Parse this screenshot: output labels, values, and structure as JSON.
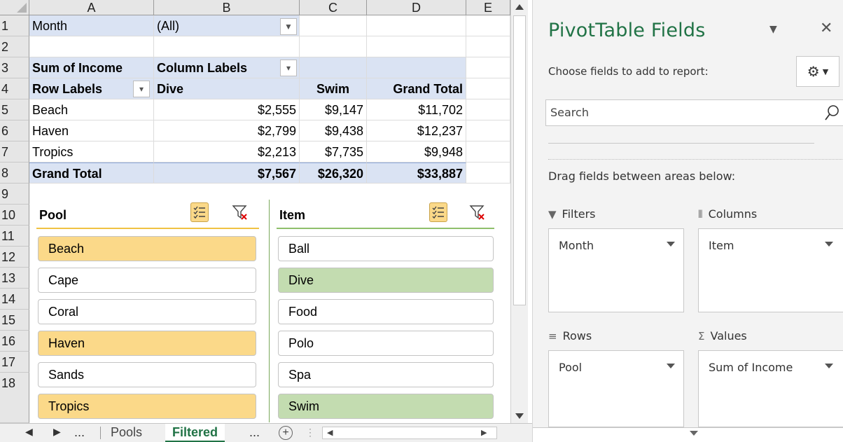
{
  "sheet": {
    "columns": [
      "A",
      "B",
      "C",
      "D",
      "E"
    ],
    "rows": [
      "1",
      "2",
      "3",
      "4",
      "5",
      "6",
      "7",
      "8",
      "9",
      "10",
      "11",
      "12",
      "13",
      "14",
      "15",
      "16",
      "17",
      "18"
    ],
    "pivot": {
      "filter_label": "Month",
      "filter_value": "(All)",
      "values_label": "Sum of Income",
      "column_labels": "Column Labels",
      "row_labels": "Row Labels",
      "col1": "Dive",
      "col2": "Swim",
      "grand_total": "Grand Total",
      "body": [
        {
          "label": "Beach",
          "dive": "$2,555",
          "swim": "$9,147",
          "total": "$11,702"
        },
        {
          "label": "Haven",
          "dive": "$2,799",
          "swim": "$9,438",
          "total": "$12,237"
        },
        {
          "label": "Tropics",
          "dive": "$2,213",
          "swim": "$7,735",
          "total": "$9,948"
        }
      ],
      "totals_label": "Grand Total",
      "totals": {
        "dive": "$7,567",
        "swim": "$26,320",
        "total": "$33,887"
      }
    }
  },
  "slicers": {
    "pool": {
      "title": "Pool",
      "items": [
        "Beach",
        "Cape",
        "Coral",
        "Haven",
        "Sands",
        "Tropics"
      ],
      "selected": [
        "Beach",
        "Haven",
        "Tropics"
      ],
      "color": "#fbd989"
    },
    "item": {
      "title": "Item",
      "items": [
        "Ball",
        "Dive",
        "Food",
        "Polo",
        "Spa",
        "Swim"
      ],
      "selected": [
        "Dive",
        "Swim"
      ],
      "color": "#c3dcb0"
    }
  },
  "tabs": {
    "ellipsis_left": "...",
    "sheet1": "Pools",
    "sheet2": "Filtered",
    "ellipsis_right": "..."
  },
  "pane": {
    "title": "PivotTable Fields",
    "choose": "Choose fields to add to report:",
    "search_placeholder": "Search",
    "drag_text": "Drag fields between areas below:",
    "filters": {
      "label": "Filters",
      "item": "Month"
    },
    "columns": {
      "label": "Columns",
      "item": "Item"
    },
    "rows": {
      "label": "Rows",
      "item": "Pool"
    },
    "values": {
      "label": "Values",
      "item": "Sum of Income"
    }
  },
  "colors": {
    "pivot_blue": "#dae3f3",
    "excel_green": "#217346",
    "pool_selected": "#fbd989",
    "item_selected": "#c3dcb0"
  }
}
